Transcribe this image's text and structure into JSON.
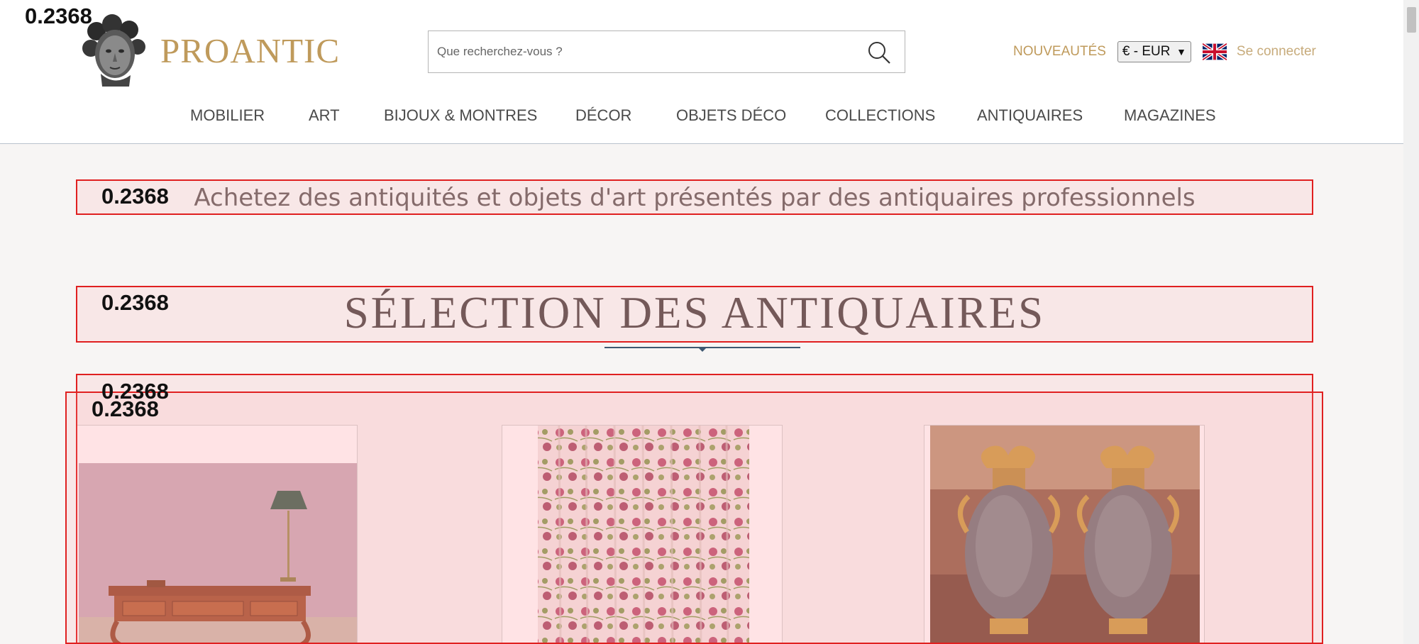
{
  "header": {
    "logo_text": "PROANTIC",
    "search_placeholder": "Que recherchez-vous ?",
    "nouveautes": "NOUVEAUTÉS",
    "currency": "€ - EUR",
    "login": "Se connecter"
  },
  "nav": {
    "items": [
      {
        "label": "MOBILIER"
      },
      {
        "label": "ART"
      },
      {
        "label": "BIJOUX & MONTRES"
      },
      {
        "label": "DÉCOR"
      },
      {
        "label": "OBJETS DÉCO"
      },
      {
        "label": "COLLECTIONS"
      },
      {
        "label": "ANTIQUAIRES"
      },
      {
        "label": "MAGAZINES"
      }
    ]
  },
  "main": {
    "tagline": "Achetez des antiquités et objets d'art présentés par des antiquaires professionnels",
    "section_title": "SÉLECTION DES ANTIQUAIRES"
  },
  "overlay": {
    "scores": [
      "0.2368",
      "0.2368",
      "0.2368",
      "0.2368",
      "0.2368"
    ],
    "box_color": "#e02020"
  },
  "colors": {
    "brand_gold": "#bf9a5b",
    "nav_text": "#4a4a4a",
    "page_bg": "#f7f5f4",
    "rule_blue": "#3e5871"
  },
  "icons": [
    "logo-bust-icon",
    "search-icon",
    "uk-flag-icon",
    "chevron-down-icon"
  ]
}
